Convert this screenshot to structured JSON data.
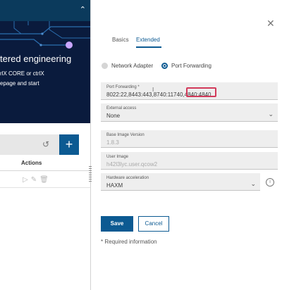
{
  "background": {
    "hero_title": "tered engineering",
    "hero_line1": "rlX CORE or ctrlX",
    "hero_line2": "epage and start",
    "table_header_actions": "Actions",
    "add_symbol": "+",
    "collapse_symbol": "^"
  },
  "dialog": {
    "tabs": [
      {
        "label": "Basics",
        "active": false
      },
      {
        "label": "Extended",
        "active": true
      }
    ],
    "network_options": [
      {
        "label": "Network Adapter",
        "selected": false
      },
      {
        "label": "Port Forwarding",
        "selected": true
      }
    ],
    "fields": {
      "port_forwarding": {
        "label": "Port Forwarding *",
        "value": "8022:22,8443:443,8740:11740,4840:4840"
      },
      "external_access": {
        "label": "External access",
        "value": "None"
      },
      "base_image_version": {
        "label": "Base Image Version",
        "value": "1.8.3"
      },
      "user_image": {
        "label": "User Image",
        "value": "h42l3lyc.user.qcow2"
      },
      "hardware_acceleration": {
        "label": "Hardware acceleration",
        "value": "HAXM"
      }
    },
    "buttons": {
      "save": "Save",
      "cancel": "Cancel"
    },
    "required_note": "* Required information"
  },
  "colors": {
    "accent": "#0c5a92",
    "highlight_box": "#d23a5a",
    "hero_bg": "#0a1b3d"
  }
}
